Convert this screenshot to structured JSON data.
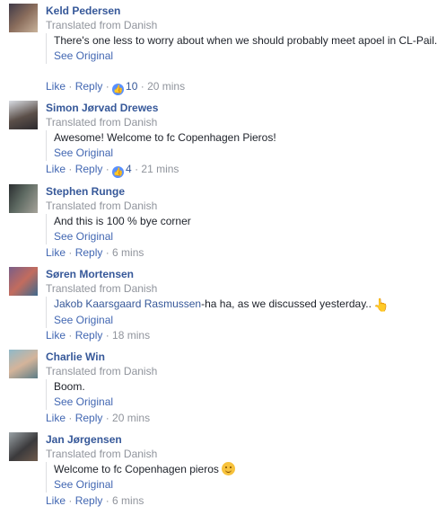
{
  "comments": [
    {
      "name": "Keld Pedersen",
      "translated": "Translated from Danish",
      "text": "There's one less to worry about when we should probably meet apoel in CL-Pail.",
      "see_original": "See Original",
      "like": "Like",
      "reply": "Reply",
      "likes": "10",
      "time": "20 mins"
    },
    {
      "name": "Simon Jørvad Drewes",
      "translated": "Translated from Danish",
      "text": "Awesome! Welcome to fc Copenhagen Pieros!",
      "see_original": "See Original",
      "like": "Like",
      "reply": "Reply",
      "likes": "4",
      "time": "21 mins"
    },
    {
      "name": "Stephen Runge",
      "translated": "Translated from Danish",
      "text": "And this is 100 % bye corner",
      "see_original": "See Original",
      "like": "Like",
      "reply": "Reply",
      "time": "6 mins"
    },
    {
      "name": "Søren Mortensen",
      "translated": "Translated from Danish",
      "mention": "Jakob Kaarsgaard Rasmussen",
      "text": "-ha ha, as we discussed yesterday..",
      "see_original": "See Original",
      "like": "Like",
      "reply": "Reply",
      "time": "18 mins"
    },
    {
      "name": "Charlie Win",
      "translated": "Translated from Danish",
      "text": "Boom.",
      "see_original": "See Original",
      "like": "Like",
      "reply": "Reply",
      "time": "20 mins"
    },
    {
      "name": "Jan Jørgensen",
      "translated": "Translated from Danish",
      "text": "Welcome to fc Copenhagen pieros",
      "see_original": "See Original",
      "like": "Like",
      "reply": "Reply",
      "time": "6 mins"
    }
  ],
  "separator": " · ",
  "icons": {
    "like_badge": "thumbs-up-icon",
    "pointing_hand": "pointing-hand-emoji-icon",
    "smile": "smiling-face-emoji-icon"
  }
}
